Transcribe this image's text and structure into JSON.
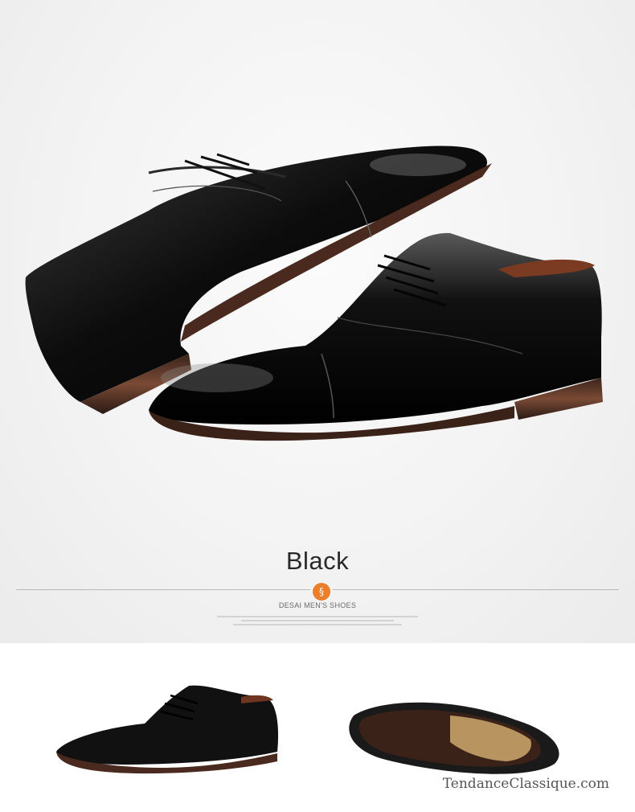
{
  "title": "Black",
  "brand_line": "DESAI MEN'S SHOES",
  "watermark": "TendanceClassique.com",
  "badge_icon": "swirl-icon",
  "colors": {
    "accent": "#ee7d2b",
    "leather": "#0d0d0d",
    "sole": "#6b3d2a",
    "insole": "#b79460"
  }
}
